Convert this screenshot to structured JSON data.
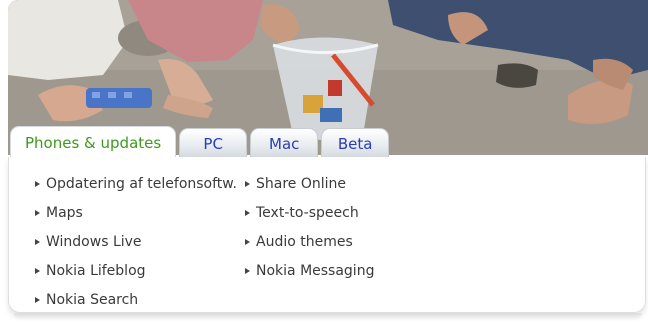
{
  "tabs": [
    {
      "label": "Phones & updates",
      "active": true
    },
    {
      "label": "PC",
      "active": false
    },
    {
      "label": "Mac",
      "active": false
    },
    {
      "label": "Beta",
      "active": false
    }
  ],
  "links": {
    "col1": [
      "Opdatering af telefonsoftw.",
      "Maps",
      "Windows Live",
      "Nokia Lifeblog",
      "Nokia Search"
    ],
    "col2": [
      "Share Online",
      "Text-to-speech",
      "Audio themes",
      "Nokia Messaging"
    ]
  },
  "colors": {
    "active_tab_text": "#3c9a1e",
    "inactive_tab_text": "#2b3cb8",
    "link_text": "#3a3a3a"
  },
  "icons": {
    "bullet": "triangle-right-icon"
  }
}
